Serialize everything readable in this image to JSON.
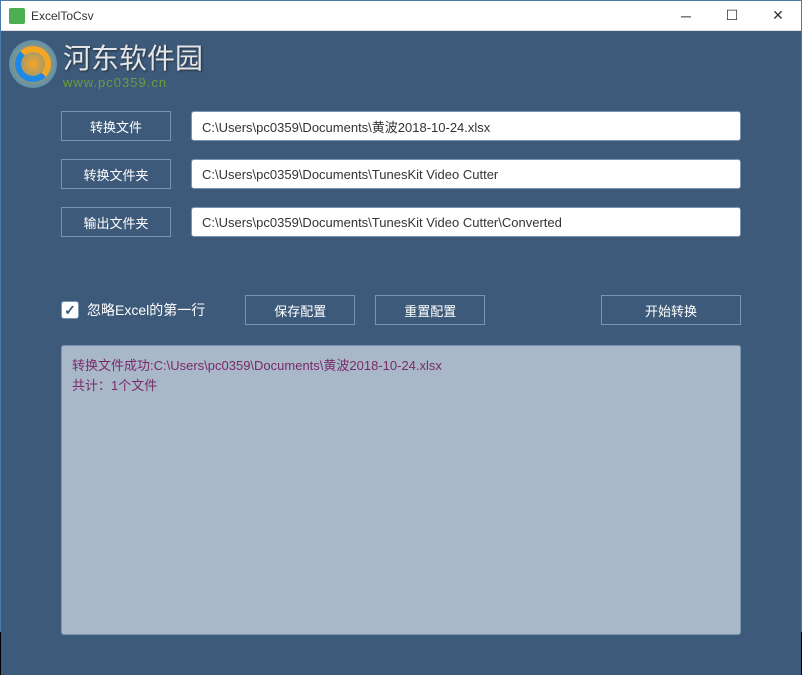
{
  "titlebar": {
    "title": "ExcelToCsv"
  },
  "watermark": {
    "title": "河东软件园",
    "url": "www.pc0359.cn"
  },
  "form": {
    "convert_file_label": "转换文件",
    "convert_file_value": "C:\\Users\\pc0359\\Documents\\黄波2018-10-24.xlsx",
    "convert_folder_label": "转换文件夹",
    "convert_folder_value": "C:\\Users\\pc0359\\Documents\\TunesKit Video Cutter",
    "output_folder_label": "输出文件夹",
    "output_folder_value": "C:\\Users\\pc0359\\Documents\\TunesKit Video Cutter\\Converted"
  },
  "options": {
    "ignore_first_row_label": "忽略Excel的第一行",
    "ignore_first_row_checked": true
  },
  "buttons": {
    "save_config": "保存配置",
    "reset_config": "重置配置",
    "start_convert": "开始转换"
  },
  "log": {
    "content": "转换文件成功:C:\\Users\\pc0359\\Documents\\黄波2018-10-24.xlsx\n共计：1个文件"
  }
}
